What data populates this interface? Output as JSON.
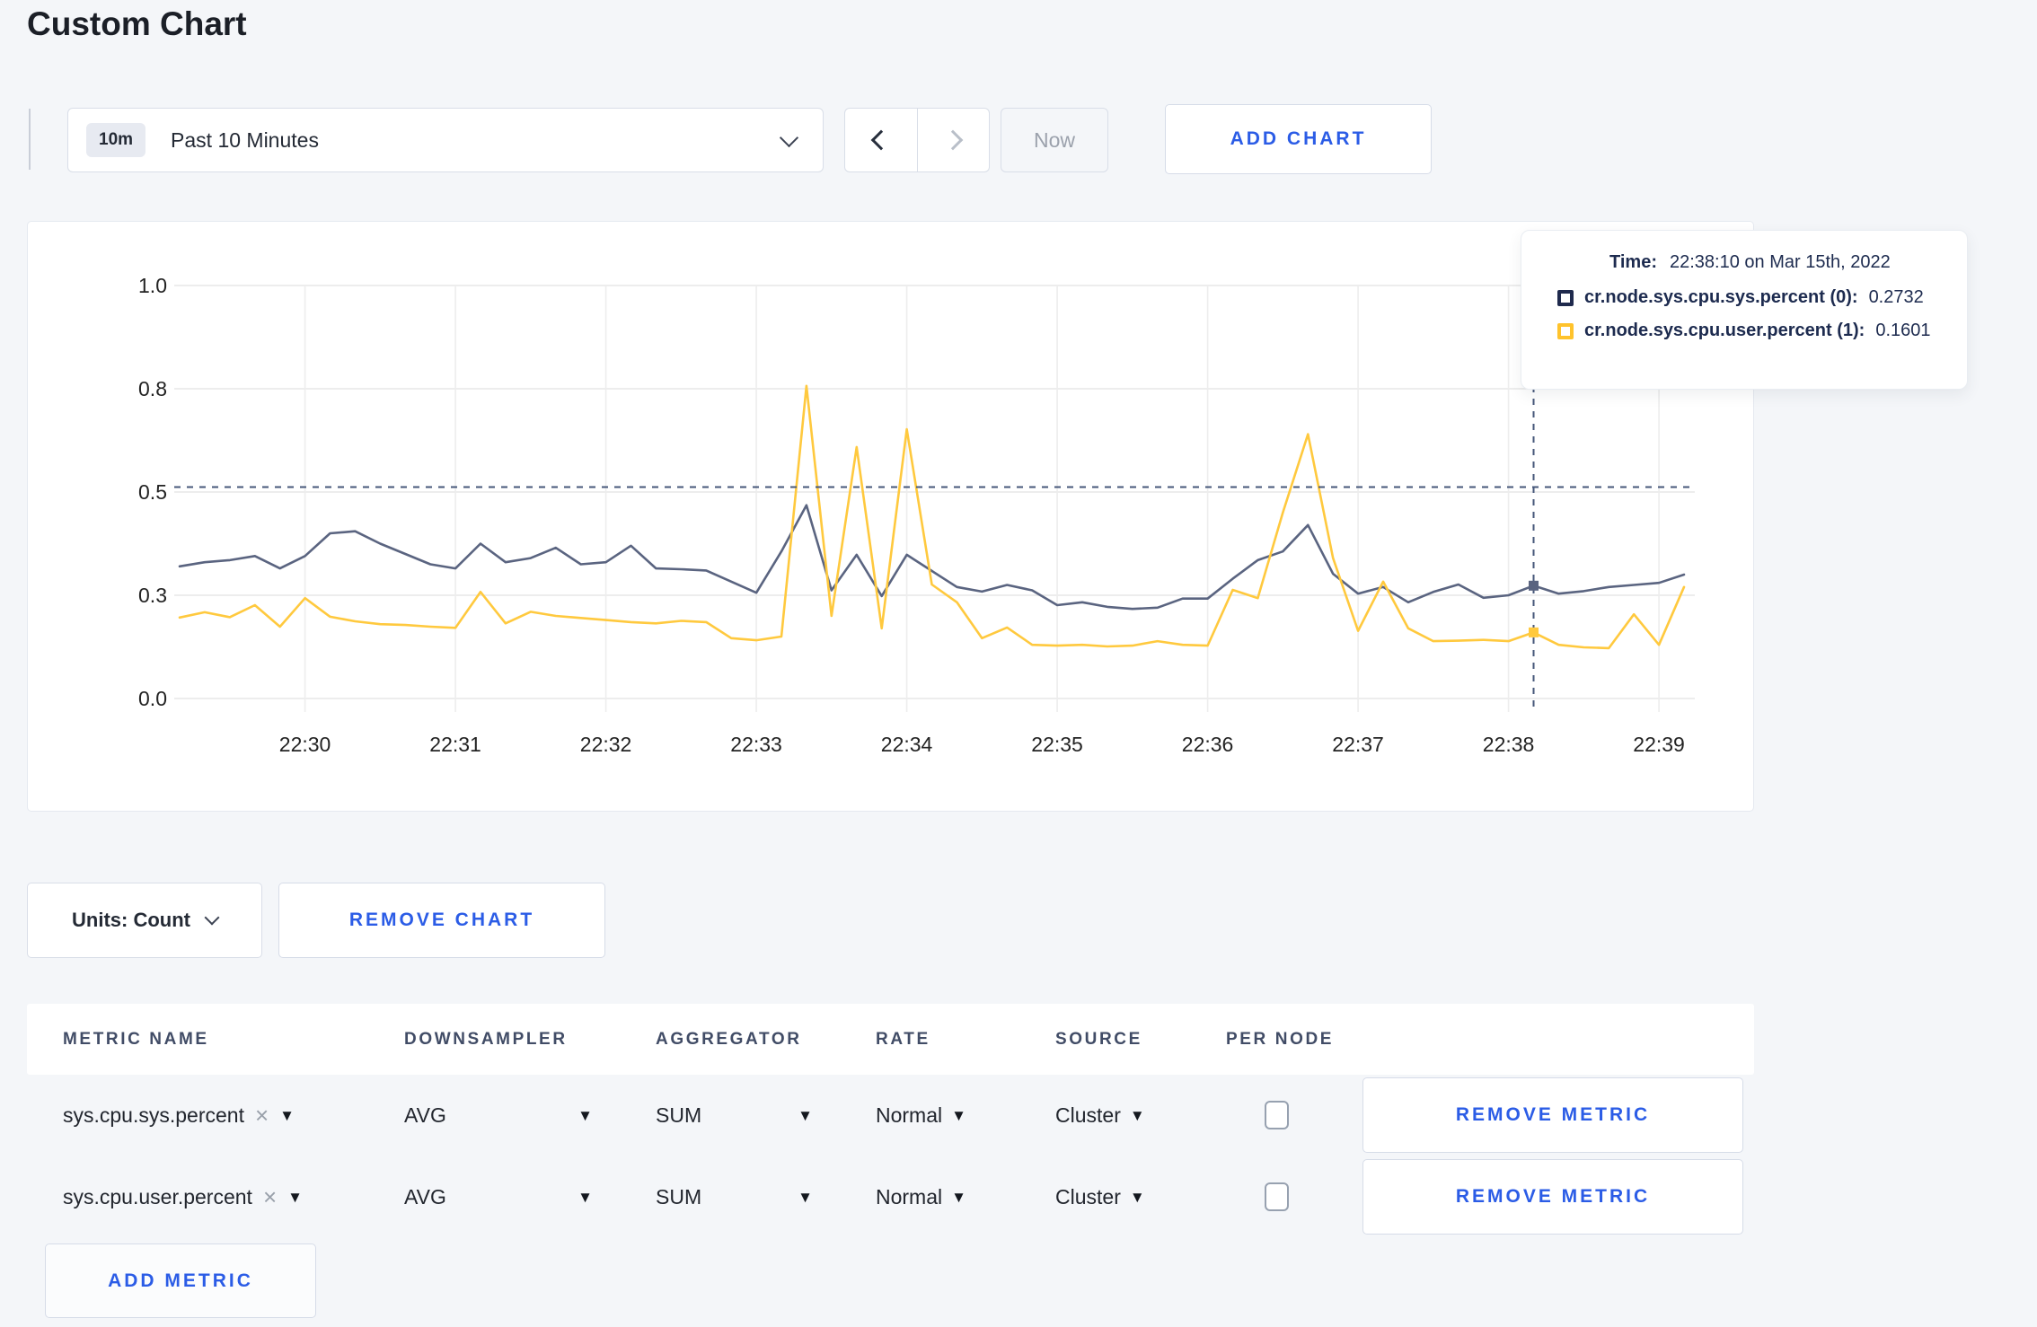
{
  "page": {
    "title": "Custom Chart"
  },
  "toolbar": {
    "time_badge": "10m",
    "time_label": "Past 10 Minutes",
    "now_label": "Now",
    "add_chart_label": "ADD CHART"
  },
  "chart_data": {
    "type": "line",
    "title": "",
    "xlabel": "",
    "ylabel": "",
    "ylim": [
      0,
      1
    ],
    "grid": true,
    "x_start": "22:29:10",
    "x_step_seconds": 10,
    "x_ticks": [
      "22:30",
      "22:31",
      "22:32",
      "22:33",
      "22:34",
      "22:35",
      "22:36",
      "22:37",
      "22:38",
      "22:39"
    ],
    "y_ticks": [
      {
        "label": "0.0",
        "value": 0
      },
      {
        "label": "0.3",
        "value": 0.25
      },
      {
        "label": "0.5",
        "value": 0.5
      },
      {
        "label": "0.8",
        "value": 0.75
      },
      {
        "label": "1.0",
        "value": 1
      }
    ],
    "legend_position": "tooltip",
    "series": [
      {
        "name": "cr.node.sys.cpu.sys.percent (0)",
        "color": "#5a6480",
        "values": [
          0.32,
          0.33,
          0.335,
          0.345,
          0.315,
          0.345,
          0.4,
          0.405,
          0.375,
          0.35,
          0.325,
          0.315,
          0.375,
          0.33,
          0.34,
          0.365,
          0.325,
          0.33,
          0.37,
          0.315,
          0.313,
          0.31,
          0.283,
          0.256,
          0.356,
          0.468,
          0.262,
          0.348,
          0.248,
          0.348,
          0.309,
          0.27,
          0.259,
          0.275,
          0.262,
          0.226,
          0.233,
          0.222,
          0.217,
          0.22,
          0.242,
          0.242,
          0.29,
          0.335,
          0.356,
          0.42,
          0.302,
          0.254,
          0.27,
          0.233,
          0.258,
          0.276,
          0.244,
          0.25,
          0.2732,
          0.254,
          0.26,
          0.27,
          0.275,
          0.28,
          0.3
        ]
      },
      {
        "name": "cr.node.sys.cpu.user.percent (1)",
        "color": "#ffc93e",
        "values": [
          0.196,
          0.209,
          0.197,
          0.226,
          0.174,
          0.243,
          0.198,
          0.187,
          0.18,
          0.178,
          0.174,
          0.171,
          0.258,
          0.182,
          0.21,
          0.2,
          0.195,
          0.19,
          0.185,
          0.182,
          0.188,
          0.185,
          0.146,
          0.141,
          0.15,
          0.757,
          0.2,
          0.609,
          0.17,
          0.652,
          0.276,
          0.233,
          0.146,
          0.172,
          0.13,
          0.128,
          0.13,
          0.126,
          0.128,
          0.139,
          0.13,
          0.128,
          0.263,
          0.243,
          0.45,
          0.64,
          0.34,
          0.164,
          0.283,
          0.17,
          0.139,
          0.14,
          0.142,
          0.139,
          0.1601,
          0.13,
          0.124,
          0.122,
          0.204,
          0.13,
          0.27
        ]
      }
    ]
  },
  "tooltip": {
    "time_label": "Time:",
    "time_value": "22:38:10 on Mar 15th, 2022",
    "crosshair_index": 54,
    "crosshair_y_value": 0.512,
    "entries": [
      {
        "name": "cr.node.sys.cpu.sys.percent (0):",
        "value": "0.2732",
        "color": "#1f2a4d"
      },
      {
        "name": "cr.node.sys.cpu.user.percent (1):",
        "value": "0.1601",
        "color": "#ffc32c"
      }
    ]
  },
  "controls": {
    "units_label": "Units: Count",
    "remove_chart_label": "REMOVE CHART",
    "add_metric_label": "ADD METRIC"
  },
  "table": {
    "headers": [
      "METRIC NAME",
      "DOWNSAMPLER",
      "AGGREGATOR",
      "RATE",
      "SOURCE",
      "PER NODE"
    ],
    "rows": [
      {
        "metric": "sys.cpu.sys.percent",
        "downsampler": "AVG",
        "aggregator": "SUM",
        "rate": "Normal",
        "source": "Cluster",
        "per_node_checked": false,
        "remove_label": "REMOVE METRIC"
      },
      {
        "metric": "sys.cpu.user.percent",
        "downsampler": "AVG",
        "aggregator": "SUM",
        "rate": "Normal",
        "source": "Cluster",
        "per_node_checked": false,
        "remove_label": "REMOVE METRIC"
      }
    ]
  },
  "colors": {
    "accent_blue": "#2b5ce6",
    "page_bg": "#f4f6f9",
    "panel_border": "#e5e9f0",
    "grid_line": "#e7e7e7",
    "crosshair": "#46577a"
  }
}
